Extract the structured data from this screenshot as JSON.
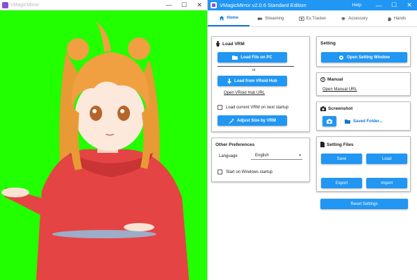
{
  "left_window": {
    "title": "VMagicMirror",
    "controls": {
      "minimize": "—",
      "maximize": "☐",
      "close": "✕"
    }
  },
  "right_window": {
    "title": "VMagicMirror v2.0.6 Standard Edition",
    "help": "Help",
    "controls": {
      "minimize": "—",
      "maximize": "☐",
      "close": "✕"
    }
  },
  "tabs": [
    {
      "label": "Home",
      "icon": "home-icon",
      "active": true
    },
    {
      "label": "Streaming",
      "icon": "video-camera-icon",
      "active": false
    },
    {
      "label": "Ex.Tracker",
      "icon": "ex-tracker-icon",
      "active": false
    },
    {
      "label": "Accessory",
      "icon": "accessory-icon",
      "active": false
    },
    {
      "label": "Hands",
      "icon": "hand-icon",
      "active": false
    }
  ],
  "load_vrm": {
    "title": "Load VRM",
    "load_file_button": "Load File on PC",
    "or_text": "or",
    "load_hub_button": "Load from VRoid Hub",
    "hub_url_link": "Open VRoid Hub URL",
    "load_on_startup": "Load current VRM on next startup",
    "adjust_size_button": "Adjust Size by VRM"
  },
  "other_prefs": {
    "title": "Other Preferences",
    "language_label": "Language",
    "language_value": "English",
    "start_on_windows": "Start on Windows startup"
  },
  "setting": {
    "title": "Setting",
    "open_button": "Open Setting Window"
  },
  "manual": {
    "title": "Manual",
    "link": "Open Manual URL"
  },
  "screenshot": {
    "title": "Screenshot",
    "saved_folder": "Saved Folder..."
  },
  "setting_files": {
    "title": "Setting Files",
    "save": "Save",
    "load": "Load",
    "export": "Export",
    "import": "Import"
  },
  "reset_button": "Reset Settings",
  "colors": {
    "accent": "#2196f3",
    "greenscreen": "#22ff00",
    "hoodie": "#e84040",
    "hair": "#f0a040"
  }
}
